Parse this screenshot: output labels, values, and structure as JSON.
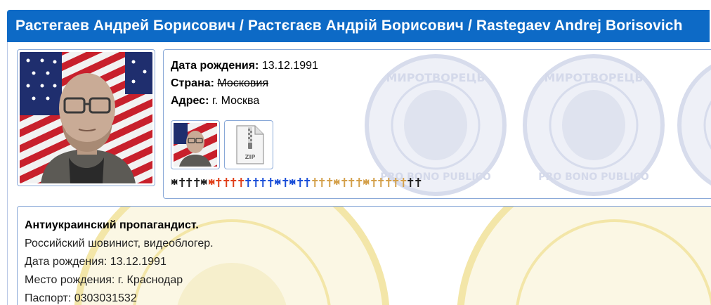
{
  "header": {
    "title": "Растегаев Андрей Борисович / Растєгаєв Андрій Борисович / Rastegaev Andrej Borisovich"
  },
  "profile": {
    "photo_icon": "person-photo",
    "fields": [
      {
        "label": "Дата рождения:",
        "value": "13.12.1991",
        "strike": false
      },
      {
        "label": "Страна:",
        "value": "Московия",
        "strike": true
      },
      {
        "label": "Адрес:",
        "value": "г. Москва",
        "strike": false
      }
    ],
    "attachments": [
      {
        "type": "photo-thumbnail",
        "icon": "person-photo"
      },
      {
        "type": "zip-file",
        "icon": "zip-file-icon",
        "label": "ZIP"
      }
    ],
    "watermark_text": {
      "top": "МИРОТВОРЕЦЬ",
      "bottom": "PRO BONO PUBLICO"
    }
  },
  "crosses": [
    {
      "kind": "iron",
      "color": "#222222"
    },
    {
      "kind": "latin",
      "color": "#222222"
    },
    {
      "kind": "latin",
      "color": "#222222"
    },
    {
      "kind": "latin",
      "color": "#222222"
    },
    {
      "kind": "iron",
      "color": "#222222"
    },
    {
      "kind": "iron",
      "color": "#e0401a"
    },
    {
      "kind": "latin",
      "color": "#e0401a"
    },
    {
      "kind": "latin",
      "color": "#e0401a"
    },
    {
      "kind": "latin",
      "color": "#e0401a"
    },
    {
      "kind": "latin",
      "color": "#e0401a"
    },
    {
      "kind": "latin",
      "color": "#1a4fd8"
    },
    {
      "kind": "latin",
      "color": "#1a4fd8"
    },
    {
      "kind": "latin",
      "color": "#1a4fd8"
    },
    {
      "kind": "latin",
      "color": "#1a4fd8"
    },
    {
      "kind": "iron",
      "color": "#1a4fd8"
    },
    {
      "kind": "latin",
      "color": "#1a4fd8"
    },
    {
      "kind": "iron",
      "color": "#1a4fd8"
    },
    {
      "kind": "latin",
      "color": "#1a4fd8"
    },
    {
      "kind": "latin",
      "color": "#1a4fd8"
    },
    {
      "kind": "latin",
      "color": "#d4a04a"
    },
    {
      "kind": "latin",
      "color": "#d4a04a"
    },
    {
      "kind": "latin",
      "color": "#d4a04a"
    },
    {
      "kind": "iron",
      "color": "#d4a04a"
    },
    {
      "kind": "latin",
      "color": "#d4a04a"
    },
    {
      "kind": "latin",
      "color": "#d4a04a"
    },
    {
      "kind": "latin",
      "color": "#d4a04a"
    },
    {
      "kind": "iron",
      "color": "#d4a04a"
    },
    {
      "kind": "latin",
      "color": "#d4a04a"
    },
    {
      "kind": "latin",
      "color": "#d4a04a"
    },
    {
      "kind": "latin",
      "color": "#d4a04a"
    },
    {
      "kind": "latin",
      "color": "#d4a04a"
    },
    {
      "kind": "latin",
      "color": "#d4a04a"
    },
    {
      "kind": "latin",
      "color": "#222222"
    },
    {
      "kind": "latin",
      "color": "#222222"
    }
  ],
  "bio": {
    "lines": [
      "Антиукраинский пропагандист.",
      "Российский шовинист, видеоблогер.",
      "Дата рождения: 13.12.1991",
      "Место рождения: г. Краснодар",
      "Паспорт: 0303031532"
    ]
  },
  "colors": {
    "header_bg": "#0d6ac6",
    "border": "#8aa9d8",
    "watermark_blue": "#1b3c8c",
    "watermark_gold": "#e8c84a"
  }
}
